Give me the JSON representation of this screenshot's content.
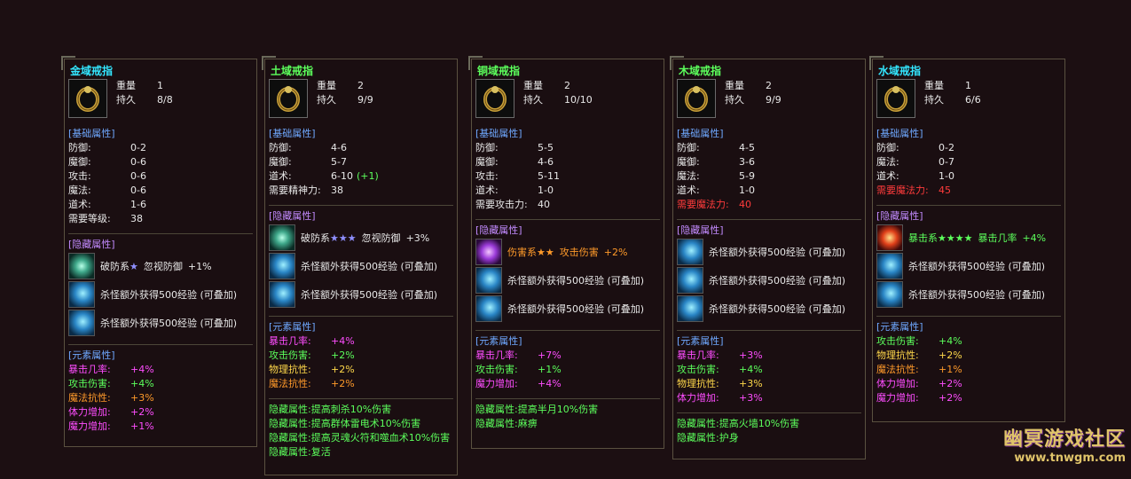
{
  "panels": [
    {
      "title": "金域戒指",
      "title_color": "cyan",
      "weight_label": "重量",
      "weight": "1",
      "dur_label": "持久",
      "dur": "8/8",
      "basic_head": "[基础属性]",
      "basic": [
        {
          "k": "防御:",
          "v": "0-2"
        },
        {
          "k": "魔御:",
          "v": "0-6"
        },
        {
          "k": "攻击:",
          "v": "0-6"
        },
        {
          "k": "魔法:",
          "v": "0-6"
        },
        {
          "k": "道术:",
          "v": "1-6"
        },
        {
          "k": "需要等级:",
          "v": "38"
        }
      ],
      "hidden_head": "[隐藏属性]",
      "hidden": [
        {
          "icon": "teal",
          "text": "破防系",
          "stars": "★",
          "stars_color": "purple",
          "extra": "忽视防御",
          "pct": "+1%"
        },
        {
          "icon": "blue",
          "text": "杀怪额外获得500经验 (可叠加)"
        },
        {
          "icon": "blue",
          "text": "杀怪额外获得500经验 (可叠加)"
        }
      ],
      "elem_head": "[元素属性]",
      "elem": [
        {
          "k": "暴击几率:",
          "v": "+4%",
          "c": "pink"
        },
        {
          "k": "攻击伤害:",
          "v": "+4%",
          "c": "lgreen"
        },
        {
          "k": "魔法抗性:",
          "v": "+3%",
          "c": "orange"
        },
        {
          "k": "体力增加:",
          "v": "+2%",
          "c": "pink"
        },
        {
          "k": "魔力增加:",
          "v": "+1%",
          "c": "pink"
        }
      ],
      "notes": []
    },
    {
      "title": "土域戒指",
      "title_color": "green",
      "weight_label": "重量",
      "weight": "2",
      "dur_label": "持久",
      "dur": "9/9",
      "basic_head": "[基础属性]",
      "basic": [
        {
          "k": "防御:",
          "v": "4-6"
        },
        {
          "k": "魔御:",
          "v": "5-7"
        },
        {
          "k": "道术:",
          "v": "6-10",
          "plus": "(+1)"
        },
        {
          "k": "需要精神力:",
          "v": "38"
        }
      ],
      "hidden_head": "[隐藏属性]",
      "hidden": [
        {
          "icon": "teal",
          "text": "破防系",
          "stars": "★★★",
          "stars_color": "purple",
          "extra": "忽视防御",
          "pct": "+3%"
        },
        {
          "icon": "blue",
          "text": "杀怪额外获得500经验 (可叠加)"
        },
        {
          "icon": "blue",
          "text": "杀怪额外获得500经验 (可叠加)"
        }
      ],
      "elem_head": "[元素属性]",
      "elem": [
        {
          "k": "暴击几率:",
          "v": "+4%",
          "c": "pink"
        },
        {
          "k": "攻击伤害:",
          "v": "+2%",
          "c": "lgreen"
        },
        {
          "k": "物理抗性:",
          "v": "+2%",
          "c": "ylw"
        },
        {
          "k": "魔法抗性:",
          "v": "+2%",
          "c": "orange"
        }
      ],
      "notes": [
        "隐藏属性:提高刺杀10%伤害",
        "隐藏属性:提高群体雷电术10%伤害",
        "隐藏属性:提高灵魂火符和噬血术10%伤害",
        "隐藏属性:复活"
      ]
    },
    {
      "title": "铜域戒指",
      "title_color": "green",
      "weight_label": "重量",
      "weight": "2",
      "dur_label": "持久",
      "dur": "10/10",
      "basic_head": "[基础属性]",
      "basic": [
        {
          "k": "防御:",
          "v": "5-5"
        },
        {
          "k": "魔御:",
          "v": "4-6"
        },
        {
          "k": "攻击:",
          "v": "5-11"
        },
        {
          "k": "道术:",
          "v": "1-0"
        },
        {
          "k": "需要攻击力:",
          "v": "40"
        }
      ],
      "hidden_head": "[隐藏属性]",
      "hidden": [
        {
          "icon": "violet",
          "text": "伤害系",
          "stars": "★★",
          "stars_color": "orange",
          "extra": "攻击伤害",
          "pct": "+2%",
          "text_color": "orange"
        },
        {
          "icon": "blue",
          "text": "杀怪额外获得500经验 (可叠加)"
        },
        {
          "icon": "blue",
          "text": "杀怪额外获得500经验 (可叠加)"
        }
      ],
      "elem_head": "[元素属性]",
      "elem": [
        {
          "k": "暴击几率:",
          "v": "+7%",
          "c": "pink"
        },
        {
          "k": "攻击伤害:",
          "v": "+1%",
          "c": "lgreen"
        },
        {
          "k": "魔力增加:",
          "v": "+4%",
          "c": "pink"
        }
      ],
      "notes": [
        "隐藏属性:提高半月10%伤害",
        "隐藏属性:麻痹"
      ]
    },
    {
      "title": "木域戒指",
      "title_color": "green",
      "weight_label": "重量",
      "weight": "2",
      "dur_label": "持久",
      "dur": "9/9",
      "basic_head": "[基础属性]",
      "basic": [
        {
          "k": "防御:",
          "v": "4-5"
        },
        {
          "k": "魔御:",
          "v": "3-6"
        },
        {
          "k": "魔法:",
          "v": "5-9"
        },
        {
          "k": "道术:",
          "v": "1-0"
        },
        {
          "k": "需要魔法力:",
          "v": "40",
          "red": true
        }
      ],
      "hidden_head": "[隐藏属性]",
      "hidden": [
        {
          "icon": "blue",
          "text": "杀怪额外获得500经验 (可叠加)"
        },
        {
          "icon": "blue",
          "text": "杀怪额外获得500经验 (可叠加)"
        },
        {
          "icon": "blue",
          "text": "杀怪额外获得500经验 (可叠加)"
        }
      ],
      "elem_head": "[元素属性]",
      "elem": [
        {
          "k": "暴击几率:",
          "v": "+3%",
          "c": "pink"
        },
        {
          "k": "攻击伤害:",
          "v": "+4%",
          "c": "lgreen"
        },
        {
          "k": "物理抗性:",
          "v": "+3%",
          "c": "ylw"
        },
        {
          "k": "体力增加:",
          "v": "+3%",
          "c": "pink"
        }
      ],
      "notes": [
        "隐藏属性:提高火墙10%伤害",
        "隐藏属性:护身"
      ]
    },
    {
      "title": "水域戒指",
      "title_color": "cyan",
      "weight_label": "重量",
      "weight": "1",
      "dur_label": "持久",
      "dur": "6/6",
      "basic_head": "[基础属性]",
      "basic": [
        {
          "k": "防御:",
          "v": "0-2"
        },
        {
          "k": "魔法:",
          "v": "0-7"
        },
        {
          "k": "道术:",
          "v": "1-0"
        },
        {
          "k": "需要魔法力:",
          "v": "45",
          "red": true
        }
      ],
      "hidden_head": "[隐藏属性]",
      "hidden": [
        {
          "icon": "fire",
          "text": "暴击系",
          "stars": "★★★★",
          "stars_color": "green",
          "extra": "暴击几率",
          "pct": "+4%",
          "text_color": "green"
        },
        {
          "icon": "blue",
          "text": "杀怪额外获得500经验 (可叠加)"
        },
        {
          "icon": "blue",
          "text": "杀怪额外获得500经验 (可叠加)"
        }
      ],
      "elem_head": "[元素属性]",
      "elem": [
        {
          "k": "攻击伤害:",
          "v": "+4%",
          "c": "lgreen"
        },
        {
          "k": "物理抗性:",
          "v": "+2%",
          "c": "ylw"
        },
        {
          "k": "魔法抗性:",
          "v": "+1%",
          "c": "orange"
        },
        {
          "k": "体力增加:",
          "v": "+2%",
          "c": "pink"
        },
        {
          "k": "魔力增加:",
          "v": "+2%",
          "c": "pink"
        }
      ],
      "notes": []
    }
  ],
  "watermark": {
    "line1": "幽冥游戏社区",
    "line2": "www.tnwgm.com"
  }
}
